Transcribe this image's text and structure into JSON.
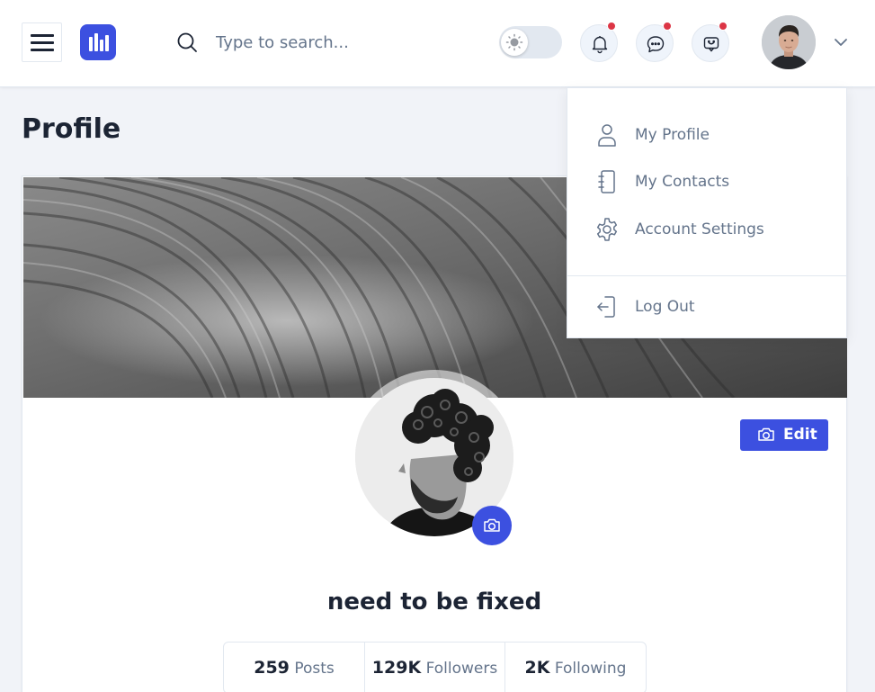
{
  "header": {
    "search_placeholder": "Type to search..."
  },
  "page": {
    "title": "Profile"
  },
  "profile": {
    "name": "need to be fixed",
    "edit_label": "Edit",
    "stats": [
      {
        "value": "259",
        "label": "Posts"
      },
      {
        "value": "129K",
        "label": "Followers"
      },
      {
        "value": "2K",
        "label": "Following"
      }
    ]
  },
  "user_menu": {
    "items": [
      {
        "label": "My Profile",
        "icon": "user-icon"
      },
      {
        "label": "My Contacts",
        "icon": "contacts-book-icon"
      },
      {
        "label": "Account Settings",
        "icon": "gear-icon"
      }
    ],
    "logout_label": "Log Out"
  },
  "colors": {
    "primary": "#3c50e0",
    "notification_dot": "#dc3545",
    "text_dark": "#1c2434",
    "text_muted": "#64748b"
  }
}
